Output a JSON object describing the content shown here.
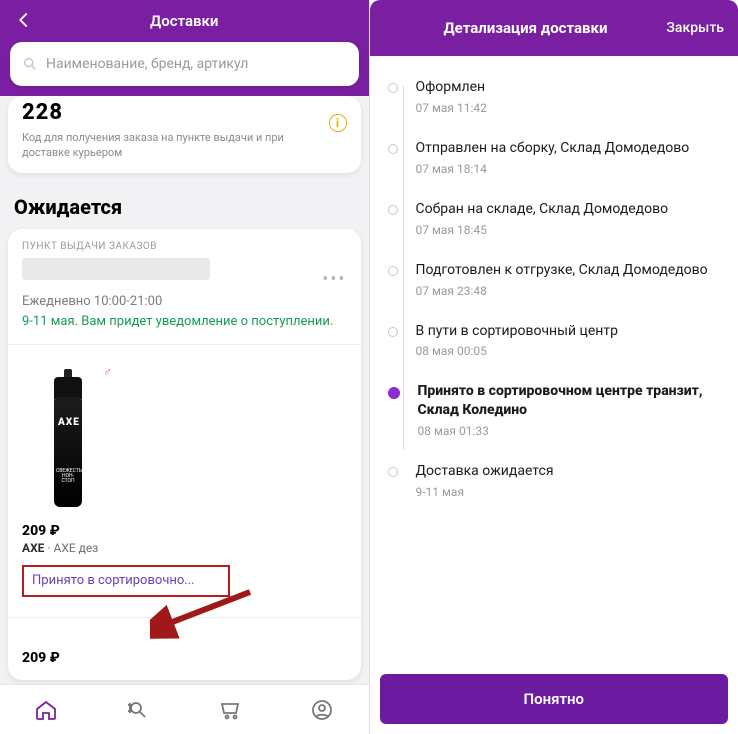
{
  "left": {
    "header": {
      "title": "Доставки"
    },
    "search": {
      "placeholder": "Наименование, бренд, артикул"
    },
    "code": {
      "number": "228",
      "desc": "Код для получения заказа на пункте выдачи и при доставке курьером"
    },
    "section_title": "Ожидается",
    "pickup": {
      "label": "ПУНКТ ВЫДАЧИ ЗАКАЗОВ",
      "schedule": "Ежедневно 10:00-21:00",
      "eta": "9-11 мая. Вам придет уведомление о поступлении."
    },
    "product": {
      "price": "209 ₽",
      "brand": "AXE",
      "name": "AXE дез",
      "status": "Принято в сортировочно...",
      "total": "209 ₽"
    }
  },
  "right": {
    "header": {
      "title": "Детализация доставки",
      "close": "Закрыть"
    },
    "timeline": [
      {
        "title": "Оформлен",
        "date": "07 мая 11:42",
        "state": "done"
      },
      {
        "title": "Отправлен на сборку, Склад Домодедово",
        "date": "07 мая 18:14",
        "state": "done"
      },
      {
        "title": "Собран на складе, Склад Домодедово",
        "date": "07 мая 18:45",
        "state": "done"
      },
      {
        "title": "Подготовлен к отгрузке, Склад Домодедово",
        "date": "07 мая 23:48",
        "state": "done"
      },
      {
        "title": "В пути в сортировочный центр",
        "date": "08 мая 00:05",
        "state": "done"
      },
      {
        "title": "Принято в сортировочном центре транзит, Склад Коледино",
        "date": "08 мая 01:33",
        "state": "current"
      },
      {
        "title": "Доставка ожидается",
        "date": "9-11 мая",
        "state": "future"
      }
    ],
    "ok_label": "Понятно"
  }
}
